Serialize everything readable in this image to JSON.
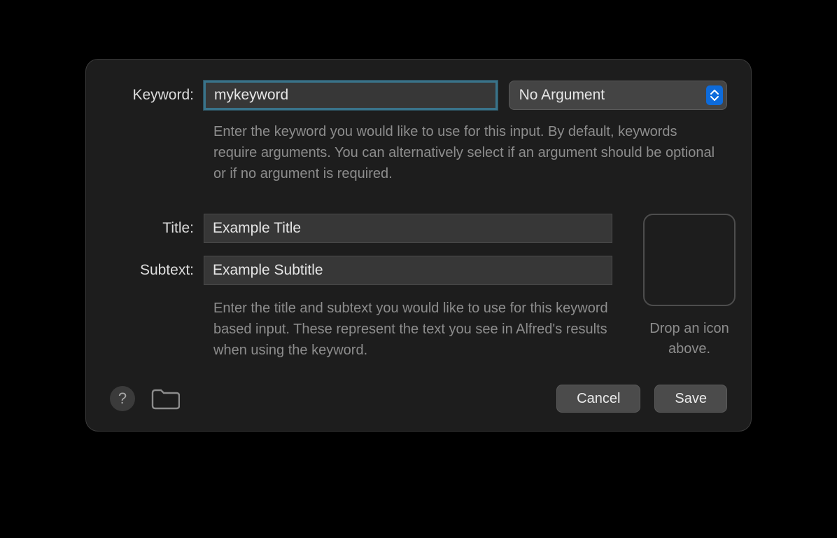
{
  "keyword": {
    "label": "Keyword:",
    "value": "mykeyword",
    "argument_select": "No Argument",
    "help": "Enter the keyword you would like to use for this input. By default, keywords require arguments. You can alternatively select if an argument should be optional or if no argument is required."
  },
  "title": {
    "label": "Title:",
    "value": "Example Title"
  },
  "subtext": {
    "label": "Subtext:",
    "value": "Example Subtitle"
  },
  "title_help": "Enter the title and subtext you would like to use for this keyword based input. These represent the text you see in Alfred's results when using the keyword.",
  "dropzone": {
    "caption": "Drop an icon above."
  },
  "footer": {
    "help_glyph": "?",
    "cancel": "Cancel",
    "save": "Save"
  }
}
